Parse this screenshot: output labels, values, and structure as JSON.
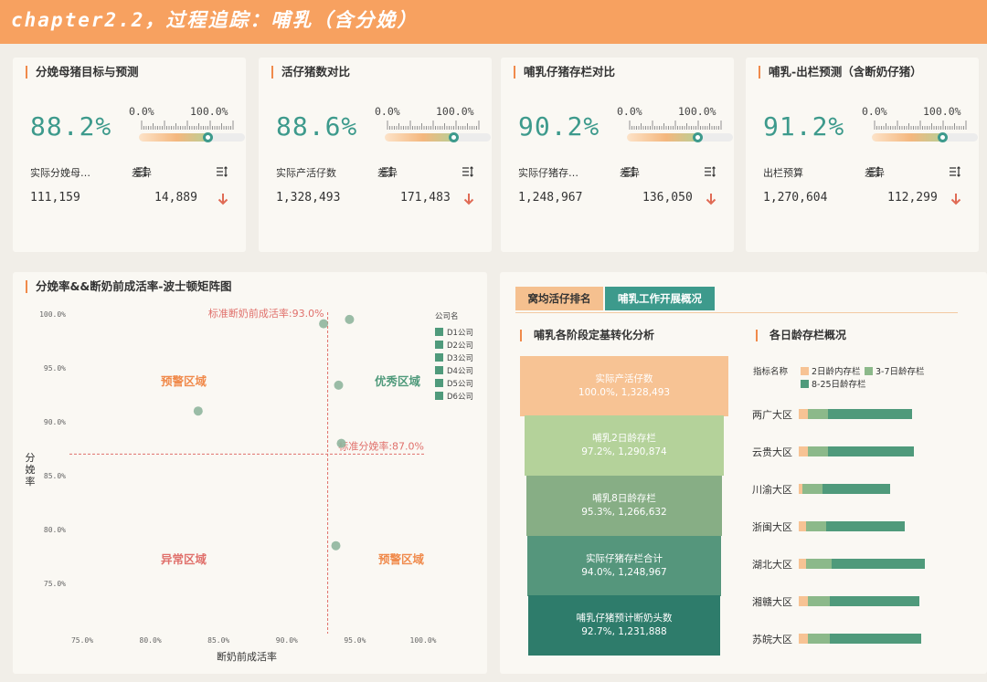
{
  "page": {
    "title": "chapter2.2，过程追踪：哺乳（含分娩）"
  },
  "colors": {
    "header": "#f7a160",
    "accent": "#f08a4b",
    "teal": "#3d9a8c",
    "down_arrow": "#e06b55",
    "peach": "#f7c394",
    "light_green": "#8cb98a",
    "dark_green": "#4f9a7b"
  },
  "kpis": [
    {
      "title": "分娩母猪目标与预测",
      "value": "88.2%",
      "progress": 0.882,
      "scale_min": "0.0%",
      "scale_max": "100.0%",
      "m1_label": "实际分娩母猪数",
      "m1_value": "111,159",
      "m2_label": "差异",
      "m2_value": "14,889",
      "trend_icon": "arrow-down"
    },
    {
      "title": "活仔猪数对比",
      "value": "88.6%",
      "progress": 0.886,
      "scale_min": "0.0%",
      "scale_max": "100.0%",
      "m1_label": "实际产活仔数",
      "m1_value": "1,328,493",
      "m2_label": "差异",
      "m2_value": "171,483",
      "trend_icon": "arrow-down"
    },
    {
      "title": "哺乳仔猪存栏对比",
      "value": "90.2%",
      "progress": 0.902,
      "scale_min": "0.0%",
      "scale_max": "100.0%",
      "m1_label": "实际仔猪存栏合计",
      "m1_value": "1,248,967",
      "m2_label": "差异",
      "m2_value": "136,050",
      "trend_icon": "arrow-down"
    },
    {
      "title": "哺乳-出栏预测（含断奶仔猪）",
      "value": "91.2%",
      "progress": 0.912,
      "scale_min": "0.0%",
      "scale_max": "100.0%",
      "m1_label": "出栏预算",
      "m1_value": "1,270,604",
      "m2_label": "差异",
      "m2_value": "112,299",
      "trend_icon": "arrow-down"
    }
  ],
  "matrix": {
    "title": "分娩率&&断奶前成活率-波士顿矩阵图",
    "quadrants": {
      "top_left": "预警区域",
      "top_right": "优秀区域",
      "bottom_left": "异常区域",
      "bottom_right": "预警区域"
    },
    "ref_lines": {
      "x_label": "标准断奶前成活率:93.0%",
      "y_label": "标准分娩率:87.0%"
    }
  },
  "chart_data": [
    {
      "type": "scatter",
      "title": "分娩率&&断奶前成活率-波士顿矩阵图",
      "xlabel": "断奶前成活率",
      "ylabel": "分娩率",
      "xlim": [
        75,
        100
      ],
      "ylim": [
        72.5,
        100
      ],
      "x_ticks": [
        "75.0%",
        "80.0%",
        "85.0%",
        "90.0%",
        "95.0%",
        "100.0%"
      ],
      "y_ticks": [
        "75.0%",
        "80.0%",
        "85.0%",
        "90.0%",
        "95.0%",
        "100.0%"
      ],
      "ref_x": 93.0,
      "ref_y": 87.0,
      "legend_title": "公司名",
      "legend_position": "top-right",
      "series": [
        {
          "name": "D1公司",
          "x": 94.6,
          "y": 99.5
        },
        {
          "name": "D2公司",
          "x": 92.7,
          "y": 99.1
        },
        {
          "name": "D3公司",
          "x": 93.8,
          "y": 93.4
        },
        {
          "name": "D4公司",
          "x": 83.5,
          "y": 91.0
        },
        {
          "name": "D5公司",
          "x": 94.0,
          "y": 88.0
        },
        {
          "name": "D6公司",
          "x": 93.6,
          "y": 78.5
        }
      ]
    },
    {
      "type": "funnel",
      "title": "哺乳各阶段定基转化分析",
      "stages": [
        {
          "name": "实际产活仔数",
          "pct": "100.0%",
          "value": "1,328,493",
          "color": "#f7c394"
        },
        {
          "name": "哺乳2日龄存栏",
          "pct": "97.2%",
          "value": "1,290,874",
          "color": "#b4d29a"
        },
        {
          "name": "哺乳8日龄存栏",
          "pct": "95.3%",
          "value": "1,266,632",
          "color": "#87ae85"
        },
        {
          "name": "实际仔猪存栏合计",
          "pct": "94.0%",
          "value": "1,248,967",
          "color": "#55967c"
        },
        {
          "name": "哺乳仔猪预计断奶头数",
          "pct": "92.7%",
          "value": "1,231,888",
          "color": "#2e7c6b"
        }
      ]
    },
    {
      "type": "bar",
      "stacked": true,
      "orientation": "horizontal",
      "title": "各日龄存栏概况",
      "legend_title": "指标名称",
      "legend_position": "top",
      "categories": [
        "两广大区",
        "云贵大区",
        "川渝大区",
        "浙闽大区",
        "湖北大区",
        "湘赣大区",
        "苏皖大区"
      ],
      "series": [
        {
          "name": "2日龄内存栏",
          "color": "#f7c394",
          "values": [
            5,
            5,
            2,
            4,
            4,
            5,
            5
          ]
        },
        {
          "name": "3-7日龄存栏",
          "color": "#8cb98a",
          "values": [
            11,
            11,
            11,
            11,
            14,
            12,
            12
          ]
        },
        {
          "name": "8-25日龄存栏",
          "color": "#4f9a7b",
          "values": [
            46,
            47,
            37,
            43,
            51,
            49,
            50
          ]
        }
      ]
    }
  ],
  "bottom_right": {
    "tabs": [
      "窝均活仔排名",
      "哺乳工作开展概况"
    ],
    "funnel_title": "哺乳各阶段定基转化分析",
    "bar_title": "各日龄存栏概况"
  }
}
